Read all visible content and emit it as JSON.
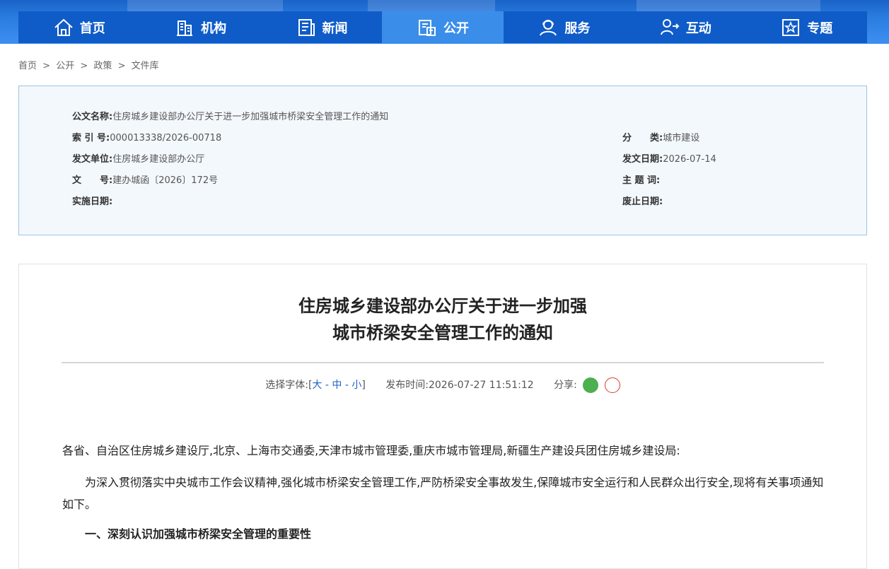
{
  "nav": {
    "items": [
      {
        "label": "首页",
        "icon": "home-icon"
      },
      {
        "label": "机构",
        "icon": "building-icon"
      },
      {
        "label": "新闻",
        "icon": "news-icon"
      },
      {
        "label": "公开",
        "icon": "disclosure-icon",
        "active": true
      },
      {
        "label": "服务",
        "icon": "service-icon"
      },
      {
        "label": "互动",
        "icon": "interaction-icon"
      },
      {
        "label": "专题",
        "icon": "topic-icon"
      }
    ],
    "colors": {
      "bar": "#0f5cc9",
      "active": "#3a8eea"
    }
  },
  "breadcrumb": [
    "首页",
    ">",
    "公开",
    ">",
    "政策",
    ">",
    "文件库"
  ],
  "meta": {
    "title_key": "公文名称:",
    "title_val": "住房城乡建设部办公厅关于进一步加强城市桥梁安全管理工作的通知",
    "index_key": "索 引 号:",
    "index_val": "000013338/2026-00718",
    "category_key": "分　　类:",
    "category_val": "城市建设",
    "issuer_key": "发文单位:",
    "issuer_val": "住房城乡建设部办公厅",
    "date_key": "发文日期:",
    "date_val": "2026-07-14",
    "docno_key": "文　　号:",
    "docno_val": "建办城函〔2026〕172号",
    "subject_key": "主 题 词:",
    "subject_val": "",
    "effective_key": "实施日期:",
    "effective_val": "",
    "abolish_key": "废止日期:",
    "abolish_val": ""
  },
  "article": {
    "title_line1": "住房城乡建设部办公厅关于进一步加强",
    "title_line2": "城市桥梁安全管理工作的通知",
    "font_label": "选择字体:[",
    "font_large": "大",
    "font_sep": " - ",
    "font_mid": "中",
    "font_small": "小",
    "font_end": "]",
    "publish_label": "发布时间:",
    "publish_time": "2026-07-27 11:51:12",
    "share_label": "分享:",
    "para1": "各省、自治区住房城乡建设厅,北京、上海市交通委,天津市城市管理委,重庆市城市管理局,新疆生产建设兵团住房城乡建设局:",
    "para2": "　　为深入贯彻落实中央城市工作会议精神,强化城市桥梁安全管理工作,严防桥梁安全事故发生,保障城市安全运行和人民群众出行安全,现将有关事项通知如下。",
    "heading1": "　　一、深刻认识加强城市桥梁安全管理的重要性"
  }
}
